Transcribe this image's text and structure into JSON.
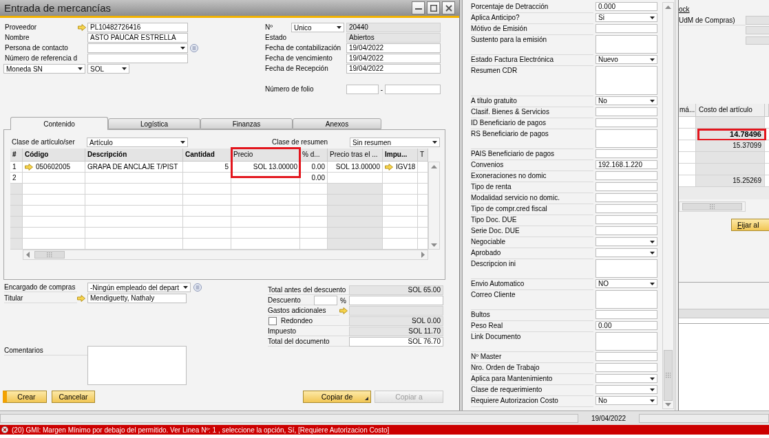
{
  "window": {
    "title": "Entrada de mercancías"
  },
  "header_left": [
    {
      "kind": "text",
      "label": "Proveedor",
      "value": "PL10482726416",
      "link": true
    },
    {
      "kind": "text",
      "label": "Nombre",
      "value": "ASTO PAUCAR ESTRELLA"
    },
    {
      "kind": "select",
      "label": "Persona de contacto",
      "list_button": true
    },
    {
      "kind": "text",
      "label": "Número de referencia d"
    },
    {
      "kind": "currency",
      "label": "Moneda SN",
      "value": "SOL"
    }
  ],
  "header_right": [
    {
      "kind": "series",
      "label": "Nº",
      "series": "Unico",
      "value": "20440",
      "readonly": true
    },
    {
      "kind": "text",
      "label": "Estado",
      "value": "Abiertos",
      "readonly": true
    },
    {
      "kind": "text",
      "label": "Fecha de contabilización",
      "value": "19/04/2022",
      "readonly": false
    },
    {
      "kind": "text",
      "label": "Fecha de vencimiento",
      "value": "19/04/2022",
      "readonly": false
    },
    {
      "kind": "text",
      "label": "Fecha de Recepción",
      "value": "19/04/2022",
      "readonly": false
    },
    {
      "kind": "folio",
      "label": "Número de folio",
      "separator": "-",
      "readonly": false
    }
  ],
  "tabs": [
    {
      "label": "Contenido",
      "selected": true
    },
    {
      "label": "Logística",
      "selected": false
    },
    {
      "label": "Finanzas",
      "selected": false
    },
    {
      "label": "Anexos",
      "selected": false
    }
  ],
  "item_class": {
    "label": "Clase de artículo/ser",
    "value": "Artículo"
  },
  "summary_class": {
    "label": "Clase de resumen",
    "value": "Sin resumen"
  },
  "lines_table": {
    "columns": [
      {
        "label": "#",
        "kind": "index",
        "bold": true,
        "highlighted": false
      },
      {
        "label": "Código",
        "kind": "text",
        "bold": true,
        "highlighted": false
      },
      {
        "label": "Descripción",
        "kind": "text",
        "bold": true,
        "highlighted": false
      },
      {
        "label": "Cantidad",
        "kind": "amount",
        "bold": true,
        "highlighted": false
      },
      {
        "label": "Precio",
        "kind": "amount",
        "bold": false,
        "highlighted": true
      },
      {
        "label": "% d...",
        "kind": "amount",
        "bold": false,
        "highlighted": false
      },
      {
        "label": "Precio tras el ...",
        "kind": "amount",
        "bold": false,
        "highlighted": false
      },
      {
        "label": "Impu...",
        "kind": "text",
        "bold": true,
        "highlighted": false
      },
      {
        "label": "T",
        "kind": "text",
        "bold": false,
        "highlighted": false
      }
    ],
    "rows": [
      {
        "number": "1",
        "code": "050602005",
        "code_link": true,
        "description": "GRAPA DE ANCLAJE T/PIST",
        "quantity": "5",
        "price": "SOL 13.00000",
        "discount": "0.00",
        "price_after_discount": "SOL 13.00000",
        "tax_code": "IGV18",
        "tax_code_link": true
      },
      {
        "number": "2",
        "discount": "0.00"
      }
    ]
  },
  "purchaser": {
    "label": "Encargado de compras",
    "value": "-Ningún empleado del depart",
    "list_button": true
  },
  "owner": {
    "label": "Titular",
    "value": "Mendiguetty, Nathaly",
    "link": true
  },
  "remarks": {
    "label": "Comentarios"
  },
  "totals": [
    {
      "kind": "amount",
      "label": "Total antes del descuento",
      "value": "SOL 65.00",
      "readonly": true
    },
    {
      "kind": "discount",
      "label": "Descuento",
      "unit": "%",
      "readonly": false
    },
    {
      "kind": "expenses",
      "label": "Gastos adicionales",
      "link": true,
      "readonly": true
    },
    {
      "kind": "rounding",
      "label": "Redondeo",
      "checked": false,
      "value": "SOL 0.00",
      "readonly": true
    },
    {
      "kind": "amount",
      "label": "Impuesto",
      "value": "SOL 11.70",
      "readonly": true
    },
    {
      "kind": "amount",
      "label": "Total del documento",
      "value": "SOL 76.70",
      "readonly": false
    }
  ],
  "actions_left": [
    {
      "label": "Crear",
      "default": true
    },
    {
      "label": "Cancelar",
      "default": false
    }
  ],
  "actions_right": [
    {
      "label": "Copiar de",
      "disabled": false,
      "dropdown": true
    },
    {
      "label": "Copiar a",
      "disabled": true,
      "dropdown": false
    }
  ],
  "user_fields": [
    {
      "kind": "text",
      "label": "Porcentaje de Detracción",
      "value": "0.000"
    },
    {
      "kind": "select",
      "label": "Aplica Anticipo?",
      "value": "Si"
    },
    {
      "kind": "text",
      "label": "Mótivo de Emisión"
    },
    {
      "kind": "memo",
      "label": "Sustento para la emisión"
    },
    {
      "kind": "select",
      "label": "Estado Factura Electrónica",
      "value": "Nuevo"
    },
    {
      "kind": "tall_memo",
      "label": "Resumen CDR"
    },
    {
      "kind": "select",
      "label": "A título gratuito",
      "value": "No"
    },
    {
      "kind": "text",
      "label": "Clasif. Bienes & Servicios"
    },
    {
      "kind": "text",
      "label": "ID Beneficiario de pagos"
    },
    {
      "kind": "memo",
      "label": "RS Beneficiario de pagos"
    },
    {
      "kind": "text",
      "label": "PAIS Beneficiario de pagos"
    },
    {
      "kind": "text",
      "label": "Convenios",
      "value": "192.168.1.220"
    },
    {
      "kind": "text",
      "label": "Exoneraciones no domic"
    },
    {
      "kind": "text",
      "label": "Tipo de renta"
    },
    {
      "kind": "text",
      "label": "Modalidad servicio no domic."
    },
    {
      "kind": "text",
      "label": "Tipo de compr.cred fiscal"
    },
    {
      "kind": "text",
      "label": "Tipo Doc. DUE"
    },
    {
      "kind": "text",
      "label": "Serie Doc. DUE"
    },
    {
      "kind": "select",
      "label": "Negociable"
    },
    {
      "kind": "select",
      "label": "Aprobado"
    },
    {
      "kind": "memo",
      "label": "Descripcion ini"
    },
    {
      "kind": "select",
      "label": "Envio Automatico",
      "value": "NO"
    },
    {
      "kind": "memo",
      "label": "Correo Cliente"
    },
    {
      "kind": "text",
      "label": "Bultos"
    },
    {
      "kind": "text",
      "label": "Peso Real",
      "value": "0.00"
    },
    {
      "kind": "memo",
      "label": "Link Documento"
    },
    {
      "kind": "text",
      "label": "Nº Master"
    },
    {
      "kind": "text",
      "label": "Nro. Orden de Trabajo"
    },
    {
      "kind": "select",
      "label": "Aplica para Mantenimiento"
    },
    {
      "kind": "select",
      "label": "Clase de requerimiento"
    },
    {
      "kind": "select",
      "label": "Requiere Autorizacion Costo",
      "value": "No"
    }
  ],
  "background_window": {
    "link": "ock",
    "caption": "UdM de Compras)",
    "table": {
      "columns": [
        "má...",
        "Costo del artículo"
      ],
      "rows": [
        {
          "highlighted": false
        },
        {
          "cost": "14.78496",
          "highlighted": true
        },
        {
          "cost": "15.37099",
          "highlighted": false
        },
        {
          "highlighted": false
        },
        {
          "highlighted": false
        },
        {
          "cost": "15.25269",
          "highlighted": false
        }
      ]
    },
    "button": "Fijar al"
  },
  "status_bar": {
    "date": "19/04/2022"
  },
  "message_bar": {
    "kind": "error",
    "text": "(20) GMI: Margen Mínimo por debajo del permitido. Ver Linea Nº: 1 , seleccione la opción, Sí, [Requiere Autorizacion Costo]"
  }
}
